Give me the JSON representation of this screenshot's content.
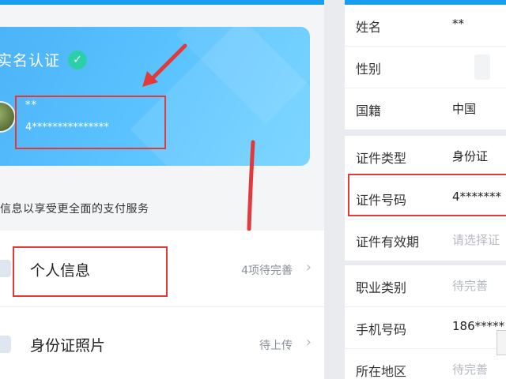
{
  "left": {
    "card": {
      "title": "实名认证",
      "verified_mark": "✓",
      "masked_name": "**",
      "masked_id": "4***************"
    },
    "promo_text": "信息以享受更全面的支付服务",
    "rows": [
      {
        "label": "个人信息",
        "status": "4项待完善",
        "chevron": "›"
      },
      {
        "label": "身份证照片",
        "status": "待上传",
        "chevron": "›"
      }
    ]
  },
  "right": {
    "groups": [
      {
        "rows": [
          {
            "label": "姓名",
            "value": "**"
          },
          {
            "label": "性别",
            "value": ""
          },
          {
            "label": "国籍",
            "value": "中国"
          }
        ]
      },
      {
        "rows": [
          {
            "label": "证件类型",
            "value": "身份证"
          },
          {
            "label": "证件号码",
            "value": "4*******"
          },
          {
            "label": "证件有效期",
            "value": "请选择证"
          }
        ]
      },
      {
        "rows": [
          {
            "label": "职业类别",
            "value": "待完善"
          },
          {
            "label": "手机号码",
            "value": "186*****"
          },
          {
            "label": "所在地区",
            "value": "待完善"
          }
        ]
      }
    ]
  },
  "colors": {
    "card_gradient_start": "#4bb3f7",
    "card_gradient_end": "#6fd2ff",
    "verified_badge": "#2bd0a8",
    "highlight_red": "#e13a3a",
    "placeholder_gray": "#b5b9bf",
    "top_strip_blue": "#1a9ff0"
  }
}
